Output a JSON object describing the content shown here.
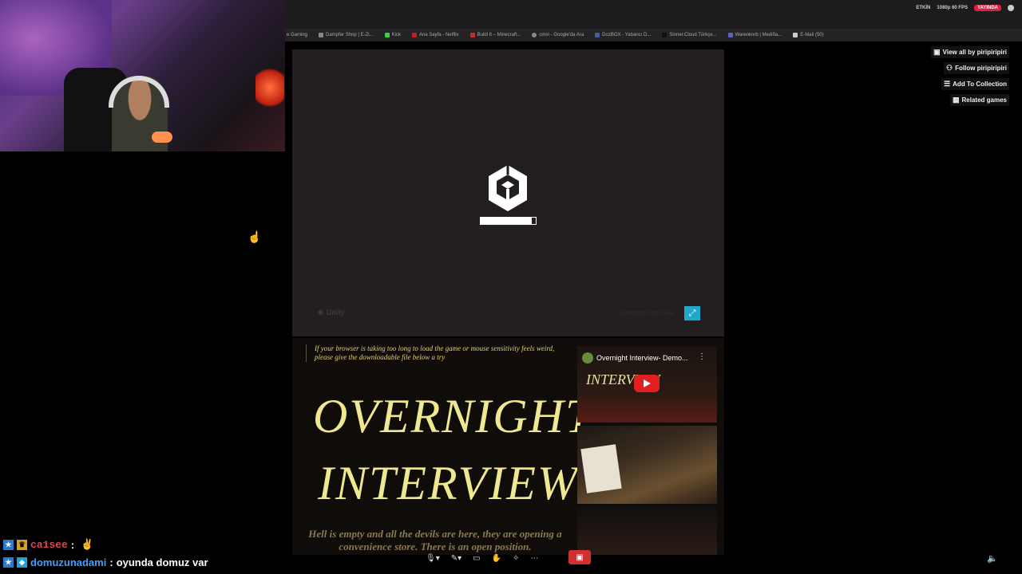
{
  "obs": {
    "etkin_label": "ETKİN",
    "quality_label": "1080p 60 FPS",
    "live_label": "YAYINDA"
  },
  "bookmarks": [
    "e Gaming",
    "Dampfer Shop | E-Zi...",
    "Kick",
    "Ana Sayfa - Netflix",
    "Build It – Minecraft...",
    "cmiri - Google'da Ara",
    "DozBOX - Yabancı D...",
    "Sinner.Cloud Türkçe...",
    "Warenkorb | Mediña...",
    "E-Mail (50)"
  ],
  "game": {
    "loading_progress": 0.93,
    "footer_unity": "Unity",
    "footer_game": "Overnight Interview",
    "fullscreen_icon": "expand-icon"
  },
  "description": {
    "browser_note": "If your browser is taking too long to load the game or mouse sensitivity feels weird, please give the downloadable file below a try",
    "title_line1": "OVERNIGHT",
    "title_line2": "INTERVIEW",
    "tagline": "Hell is empty and all the devils are here, they are opening a convenience store. There is an open position."
  },
  "video": {
    "title": "Overnight Interview- Demo...",
    "overlay_text": "INTERVIEW"
  },
  "actions": [
    {
      "label": "View all by piripiripiri",
      "icon": "user-grid-icon"
    },
    {
      "label": "Follow piripiripiri",
      "icon": "user-plus-icon"
    },
    {
      "label": "Add To Collection",
      "icon": "playlist-add-icon"
    },
    {
      "label": "Related games",
      "icon": "map-icon"
    }
  ],
  "chat": [
    {
      "user": "ca1see",
      "message": ""
    },
    {
      "user": "domuzunadami",
      "message": "oyunda domuz var"
    }
  ],
  "colors": {
    "live_red": "#e02040",
    "unity_bg": "#231f20",
    "title_yellow": "#f0e890",
    "fullscreen_cyan": "#1fa8c9"
  }
}
